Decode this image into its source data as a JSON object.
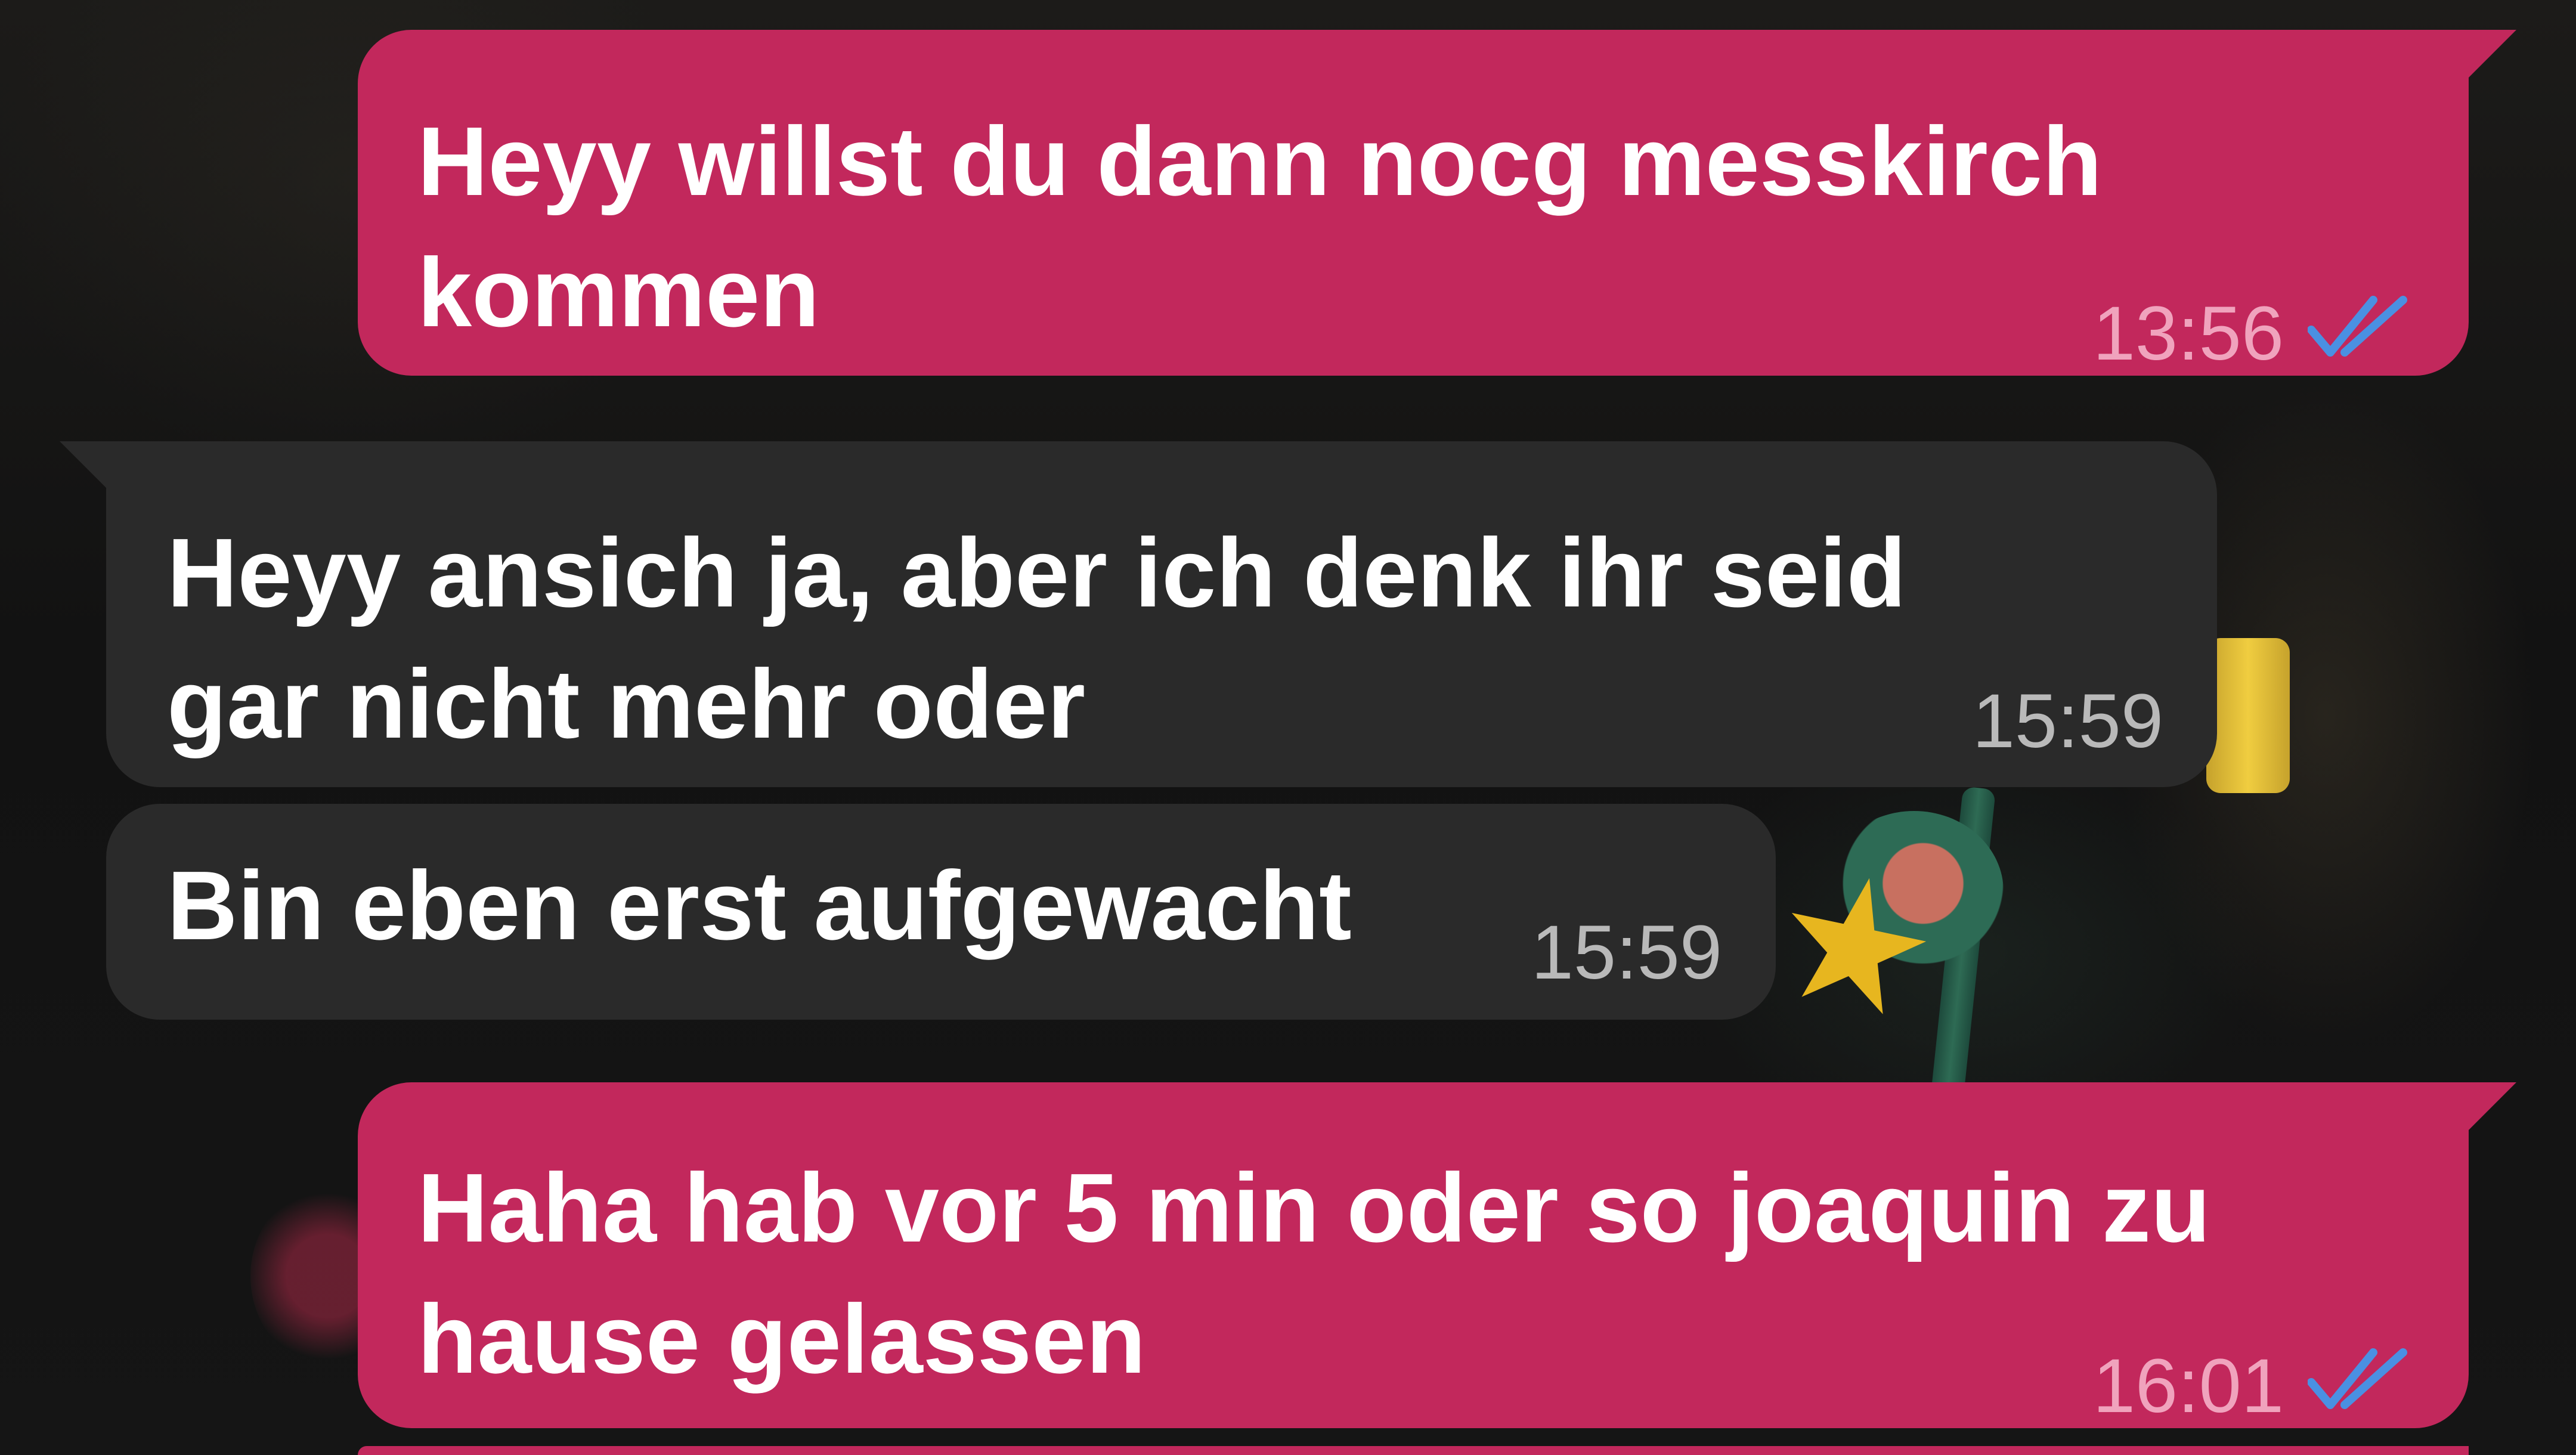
{
  "chat": {
    "messages": [
      {
        "direction": "outgoing",
        "lines": [
          "Heyy willst du dann nocg messkirch",
          "kommen"
        ],
        "time": "13:56",
        "status": "read",
        "status_icon": "double-check-icon"
      },
      {
        "direction": "incoming",
        "lines": [
          "Heyy ansich ja, aber ich denk ihr seid",
          "gar nicht mehr oder"
        ],
        "time": "15:59"
      },
      {
        "direction": "incoming",
        "lines": [
          "Bin eben erst aufgewacht"
        ],
        "time": "15:59"
      },
      {
        "direction": "outgoing",
        "lines": [
          "Haha hab vor 5 min oder so joaquin zu",
          "hause gelassen"
        ],
        "time": "16:01",
        "status": "read",
        "status_icon": "double-check-icon"
      }
    ]
  },
  "colors": {
    "outgoing_bubble": "#c2285c",
    "incoming_bubble": "#2a2a2a",
    "read_check": "#4a90e2",
    "text": "#ffffff"
  }
}
